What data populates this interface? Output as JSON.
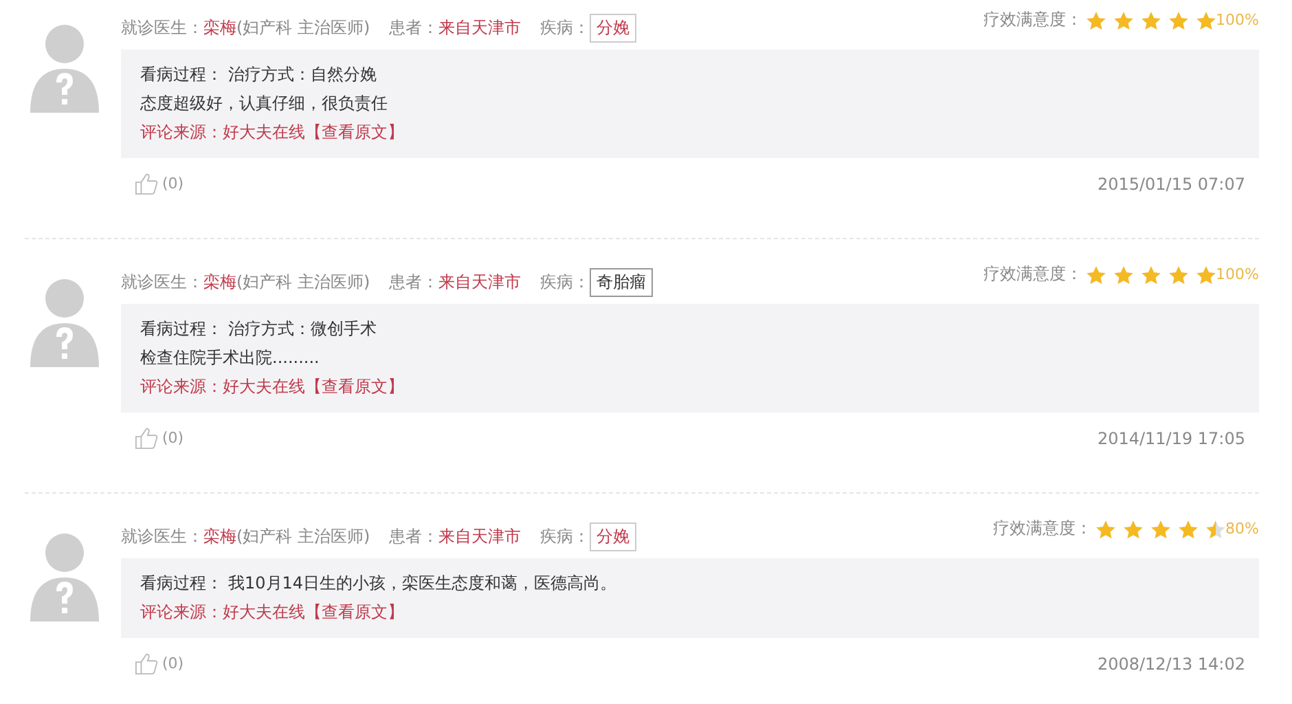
{
  "reviews": [
    {
      "doctor_label": "就诊医生：",
      "doctor": "栾梅",
      "doctor_title": "(妇产科 主治医师)",
      "patient_label": "患者：",
      "patient": "来自天津市",
      "disease_label": "疾病：",
      "disease": {
        "label": "分娩",
        "color": "#c0394b"
      },
      "rating_label": "疗效满意度：",
      "stars": 5,
      "rating": "100%",
      "process_label": "看病过程：",
      "process": "治疗方式：自然分娩",
      "lines": [
        "态度超级好，认真仔细，很负责任"
      ],
      "source": "评论来源：好大夫在线",
      "source_link": "【查看原文】",
      "likes": "(0)",
      "time": "2015/01/15 07:07"
    },
    {
      "doctor_label": "就诊医生：",
      "doctor": "栾梅",
      "doctor_title": "(妇产科 主治医师)",
      "patient_label": "患者：",
      "patient": "来自天津市",
      "disease_label": "疾病：",
      "disease": {
        "label": "奇胎瘤",
        "color": "#333333"
      },
      "rating_label": "疗效满意度：",
      "stars": 5,
      "rating": "100%",
      "process_label": "看病过程：",
      "process": "治疗方式：微创手术",
      "lines": [
        "检查住院手术出院........."
      ],
      "source": "评论来源：好大夫在线",
      "source_link": "【查看原文】",
      "likes": "(0)",
      "time": "2014/11/19 17:05"
    },
    {
      "doctor_label": "就诊医生：",
      "doctor": "栾梅",
      "doctor_title": "(妇产科 主治医师)",
      "patient_label": "患者：",
      "patient": "来自天津市",
      "disease_label": "疾病：",
      "disease": {
        "label": "分娩",
        "color": "#c0394b"
      },
      "rating_label": "疗效满意度：",
      "stars": 4.5,
      "rating": "80%",
      "process_label": "看病过程：",
      "process": "我10月14日生的小孩，栾医生态度和蔼，医德高尚。",
      "source": "评论来源：好大夫在线",
      "source_link": "【查看原文】",
      "likes": "(0)",
      "time": "2008/12/13 14:02"
    }
  ]
}
